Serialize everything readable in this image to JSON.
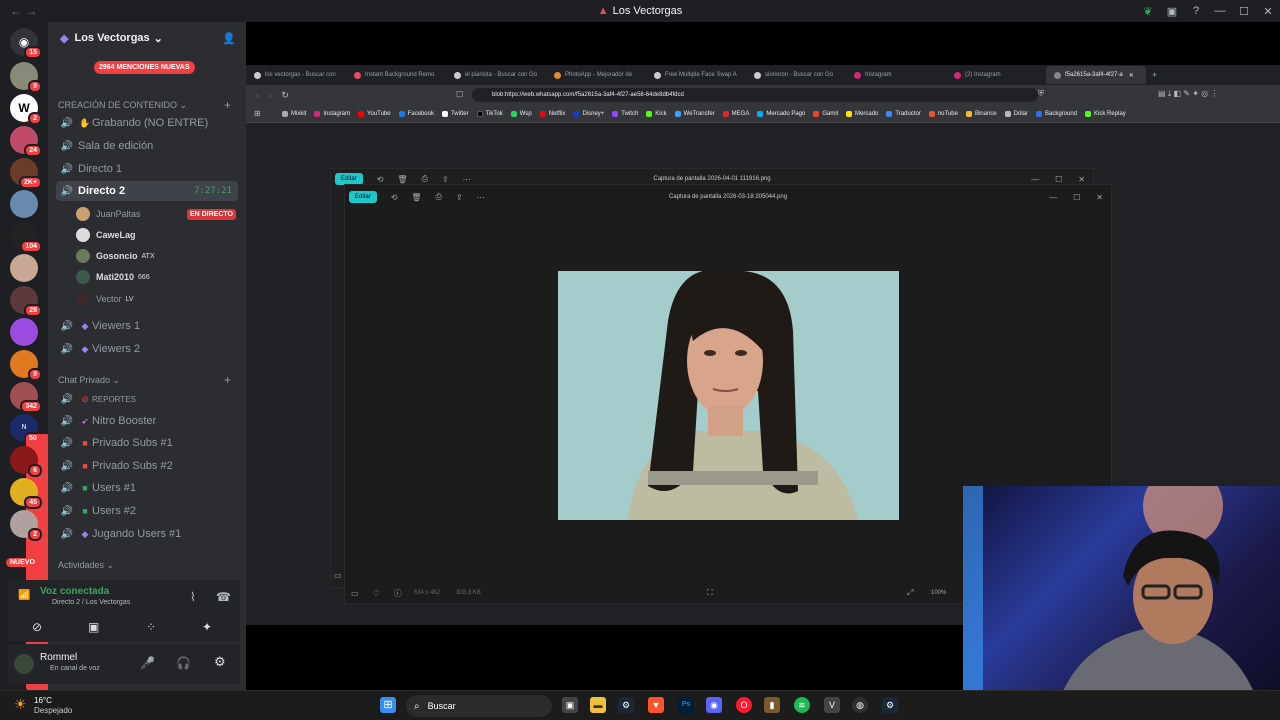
{
  "window": {
    "title": "Los Vectorgas"
  },
  "server": {
    "name": "Los Vectorgas",
    "mentions_label": "2964 MENCIONES NUEVAS"
  },
  "rail_badges": [
    "15",
    "9",
    "2",
    "24",
    "2K+",
    "104",
    "28",
    "9",
    "342",
    "50",
    "6",
    "45",
    "2"
  ],
  "rail_new_label": "NUEVO",
  "categories": {
    "creacion": "CREACIÓN DE CONTENIDO",
    "chat_privado": "Chat Privado",
    "actividades": "Actividades"
  },
  "channels": [
    {
      "emoji": "✋",
      "label": "Grabando (NO ENTRE)"
    },
    {
      "label": "Sala de edición"
    },
    {
      "label": "Directo 1"
    },
    {
      "label": "Directo 2",
      "timer": "7:27:21"
    }
  ],
  "voice_users": [
    {
      "name": "JuanPaltas",
      "live": "EN DIRECTO"
    },
    {
      "name": "CaweLag"
    },
    {
      "name": "Gosoncio",
      "tag": "ATX"
    },
    {
      "name": "Mati2010",
      "tag": "666"
    },
    {
      "name": "Vector",
      "tag": "LV"
    }
  ],
  "channels2": [
    "Viewers 1",
    "Viewers 2"
  ],
  "private_channels": [
    {
      "label": "REPORTES",
      "small": true
    },
    {
      "label": "Nitro Booster"
    },
    {
      "label": "Privado Subs #1"
    },
    {
      "label": "Privado Subs #2"
    },
    {
      "label": "Users #1"
    },
    {
      "label": "Users #2"
    },
    {
      "label": "Jugando Users #1"
    }
  ],
  "voice_panel": {
    "status": "Voz conectada",
    "channel": "Directo 2 / Los Vectorgas"
  },
  "user_panel": {
    "name": "Rommel",
    "status": "En canal de voz"
  },
  "browser": {
    "tabs": [
      "los vectorgas - Buscar con",
      "Instant Background Remo",
      "el pianista - Buscar con Go",
      "PhotoApp - Mejorador de",
      "Free Multiple Face Swap A",
      "sionoron - Buscar con Go",
      "Instagram",
      "(2) Instagram",
      "f5a2615a-3af4-4f27-a"
    ],
    "url": "blob:https://web.whatsapp.com/f5a2615a-3af4-4f27-ae58-64de8db4fdcd",
    "bookmarks": [
      "Mixkit",
      "Instagram",
      "YouTube",
      "Facebook",
      "Twitter",
      "TikTok",
      "Wsp",
      "Netflix",
      "Disney+",
      "Twitch",
      "Kick",
      "WeTransfer",
      "MEGA",
      "Mercado Pago",
      "Gamil",
      "Mercado",
      "Traductor",
      "noTube",
      "Binance",
      "Dólar",
      "Background",
      "Kick Replay"
    ]
  },
  "viewer_back": {
    "edit": "Editar",
    "title": "Captura de pantalla 2026-04-01 111916.png"
  },
  "viewer_front": {
    "edit": "Editar",
    "title": "Captura de pantalla 2026-03-18 205044.png",
    "dims": "634 x 462",
    "size": "328,3 KB",
    "zoom": "100%"
  },
  "weather": {
    "temp": "16°C",
    "desc": "Despejado"
  },
  "taskbar": {
    "search": "Buscar"
  }
}
